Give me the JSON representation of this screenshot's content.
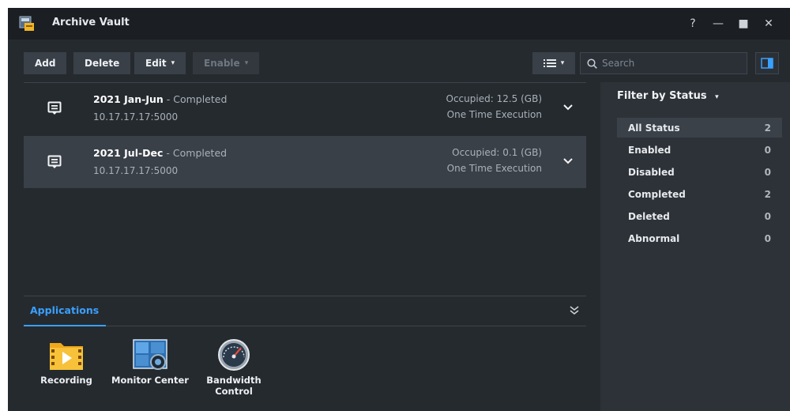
{
  "window": {
    "title": "Archive Vault",
    "help": "?",
    "minimize": "—",
    "maximize": "■",
    "close": "✕"
  },
  "toolbar": {
    "add_label": "Add",
    "delete_label": "Delete",
    "edit_label": "Edit",
    "enable_label": "Enable",
    "search_placeholder": "Search",
    "caret": "▾"
  },
  "tasks": [
    {
      "name": "2021 Jan-Jun",
      "status": " - Completed",
      "address": "10.17.17.17:5000",
      "occupied": "Occupied: 12.5 (GB)",
      "schedule": "One Time Execution",
      "selected": false
    },
    {
      "name": "2021 Jul-Dec",
      "status": " - Completed",
      "address": "10.17.17.17:5000",
      "occupied": "Occupied: 0.1 (GB)",
      "schedule": "One Time Execution",
      "selected": true
    }
  ],
  "filter": {
    "title": "Filter by Status",
    "items": [
      {
        "label": "All Status",
        "count": "2",
        "active": true
      },
      {
        "label": "Enabled",
        "count": "0",
        "active": false
      },
      {
        "label": "Disabled",
        "count": "0",
        "active": false
      },
      {
        "label": "Completed",
        "count": "2",
        "active": false
      },
      {
        "label": "Deleted",
        "count": "0",
        "active": false
      },
      {
        "label": "Abnormal",
        "count": "0",
        "active": false
      }
    ]
  },
  "applications": {
    "tab_label": "Applications",
    "items": [
      {
        "label": "Recording",
        "icon": "recording-icon"
      },
      {
        "label": "Monitor Center",
        "icon": "monitor-center-icon"
      },
      {
        "label": "Bandwidth Control",
        "icon": "bandwidth-control-icon"
      }
    ]
  },
  "colors": {
    "accent": "#3aa0ff",
    "window_bg": "#252a2f",
    "titlebar_bg": "#1b1f23",
    "sidebar_bg": "#2d3238"
  }
}
